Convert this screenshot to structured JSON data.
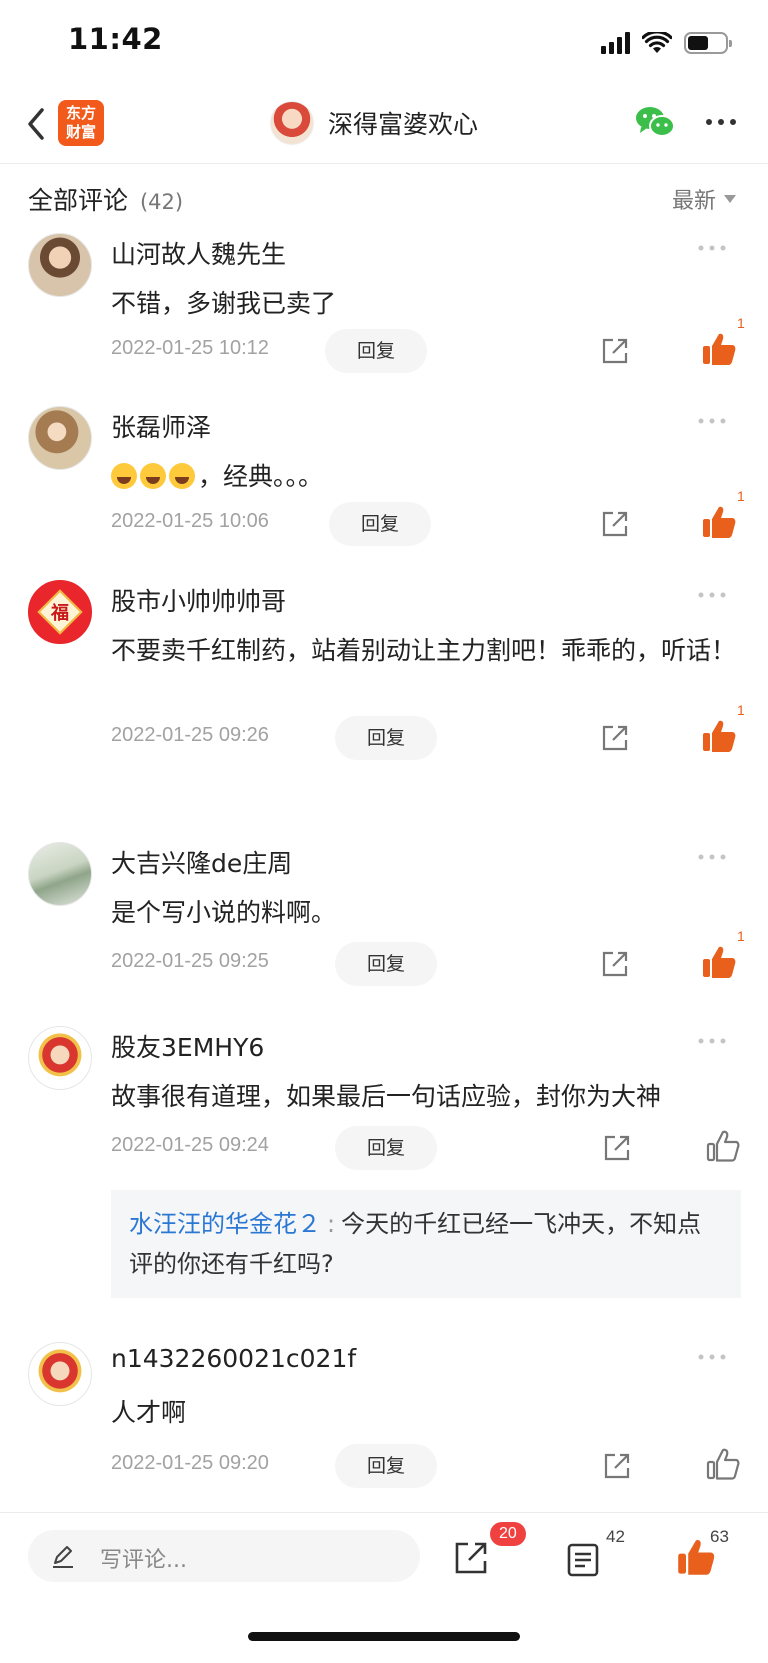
{
  "status_bar": {
    "time": "11:42"
  },
  "nav": {
    "logo_line1": "东方",
    "logo_line2": "财富",
    "title": "深得富婆欢心"
  },
  "section": {
    "title": "全部评论",
    "count": "(42)",
    "sort": "最新"
  },
  "comments": [
    {
      "name": "山河故人魏先生",
      "text": "不错，多谢我已卖了",
      "time": "2022-01-25 10:12",
      "reply": "回复",
      "likes": "1"
    },
    {
      "name": "张磊师泽",
      "text": "，经典。。。",
      "time": "2022-01-25 10:06",
      "reply": "回复",
      "likes": "1"
    },
    {
      "name": "股市小帅帅帅哥",
      "text": "不要卖千红制药，站着别动让主力割吧！乖乖的，听话！",
      "time": "2022-01-25 09:26",
      "reply": "回复",
      "likes": "1",
      "avatar_char": "福"
    },
    {
      "name": "大吉兴隆de庄周",
      "text": "是个写小说的料啊。",
      "time": "2022-01-25 09:25",
      "reply": "回复",
      "likes": "1"
    },
    {
      "name": "股友3EMHY6",
      "text": "故事很有道理，如果最后一句话应验，封你为大神",
      "time": "2022-01-25 09:24",
      "reply": "回复",
      "quote": {
        "user": "水汪汪的华金花２",
        "colon": ":",
        "text": "今天的千红已经一飞冲天，不知点评的你还有千红吗?"
      }
    },
    {
      "name": "n1432260021c021f",
      "text": "人才啊",
      "time": "2022-01-25 09:20",
      "reply": "回复"
    }
  ],
  "bottom_bar": {
    "placeholder": "写评论...",
    "share_badge": "20",
    "comments_count": "42",
    "likes_count": "63"
  },
  "colors": {
    "accent": "#f25a1b",
    "like": "#e8601c",
    "link": "#2b78d4",
    "badge": "#f04141"
  }
}
